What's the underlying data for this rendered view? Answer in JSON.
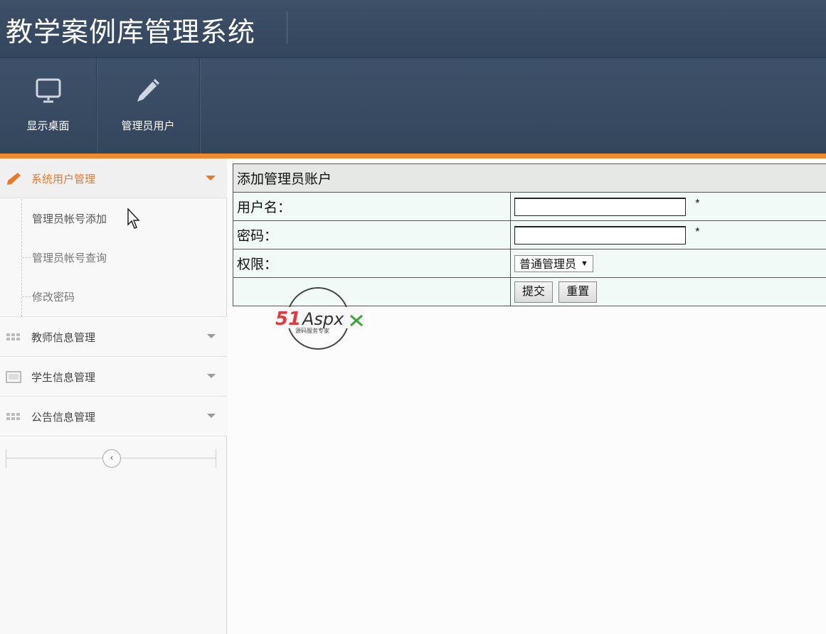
{
  "header": {
    "app_title": "教学案例库管理系统"
  },
  "nav": {
    "items": [
      {
        "label": "显示桌面",
        "icon": "monitor-icon"
      },
      {
        "label": "管理员用户",
        "icon": "pencil-icon"
      }
    ]
  },
  "sidebar": {
    "groups": [
      {
        "label": "系统用户管理",
        "icon": "pencil-icon",
        "expanded": true,
        "items": [
          {
            "label": "管理员帐号添加"
          },
          {
            "label": "管理员帐号查询"
          },
          {
            "label": "修改密码"
          }
        ]
      },
      {
        "label": "教师信息管理",
        "icon": "grid-icon",
        "expanded": false
      },
      {
        "label": "学生信息管理",
        "icon": "image-icon",
        "expanded": false
      },
      {
        "label": "公告信息管理",
        "icon": "grid-icon",
        "expanded": false
      }
    ],
    "collapse_glyph": "‹"
  },
  "form": {
    "caption": "添加管理员账户",
    "username_label": "用户名：",
    "username_value": "",
    "password_label": "密码：",
    "password_value": "",
    "required_mark": "*",
    "permission_label": "权限：",
    "permission_selected": "普通管理员",
    "submit_label": "提交",
    "reset_label": "重置"
  },
  "watermark": {
    "brand_red": "51",
    "brand_dark": "Aspx",
    "tagline": "源码服务专家"
  },
  "colors": {
    "header_bg": "#3a4d65",
    "accent_orange": "#f08a2c",
    "active_menu_text": "#e8782a"
  }
}
